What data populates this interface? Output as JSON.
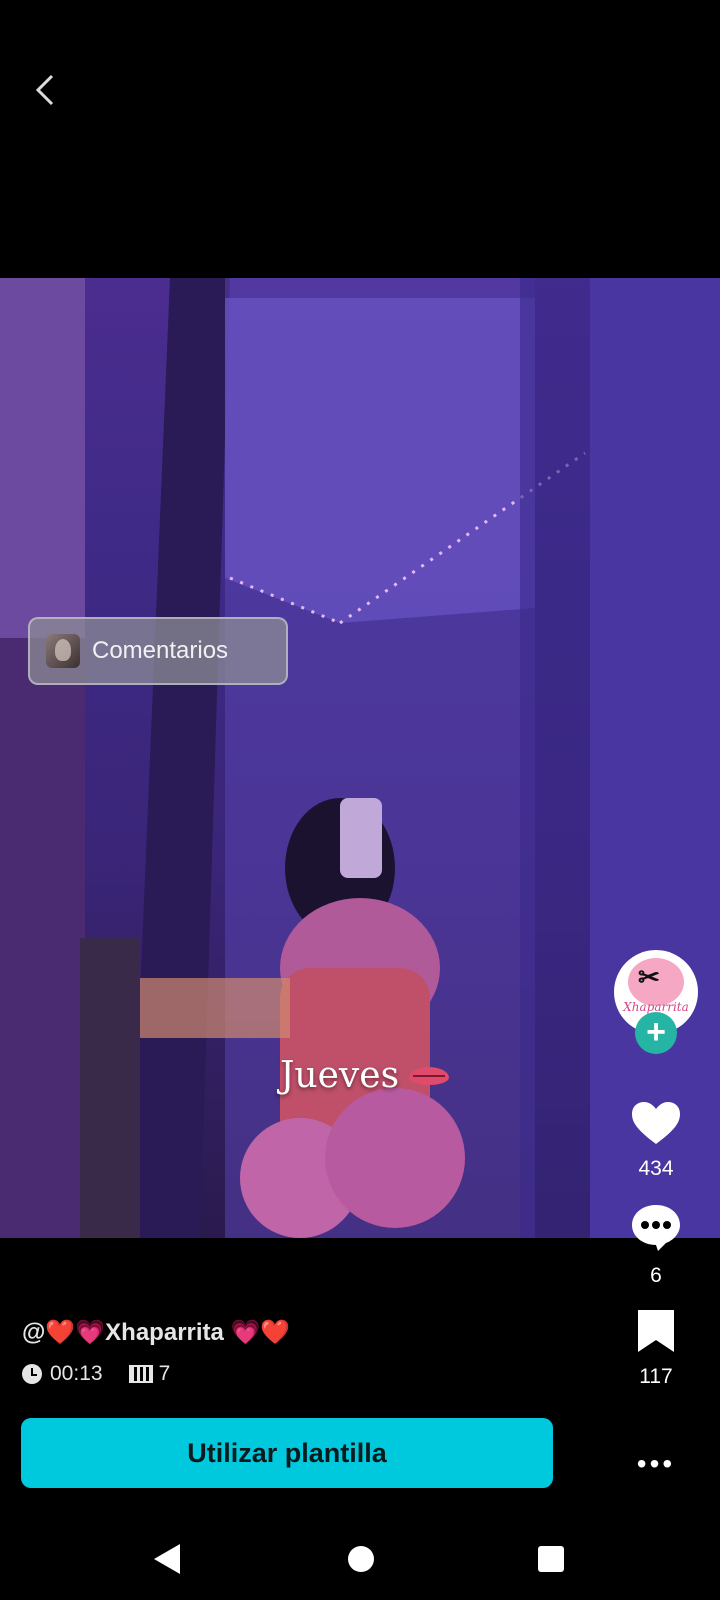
{
  "header": {
    "back_icon": "chevron-left-icon"
  },
  "video": {
    "comments_chip_label": "Comentarios",
    "overlay_caption": "Jueves"
  },
  "creator": {
    "avatar_text": "Xhaparrita",
    "follow_symbol": "+"
  },
  "actions": {
    "likes": "434",
    "comments": "6",
    "saves": "117",
    "more_symbol": "•••"
  },
  "post": {
    "username": "@❤️💗Xhaparrita 💗❤️",
    "duration": "00:13",
    "clips": "7"
  },
  "cta": {
    "label": "Utilizar plantilla"
  },
  "colors": {
    "accent": "#00c8dd",
    "follow": "#26b4a4",
    "video_tint": "#3e2a86"
  }
}
